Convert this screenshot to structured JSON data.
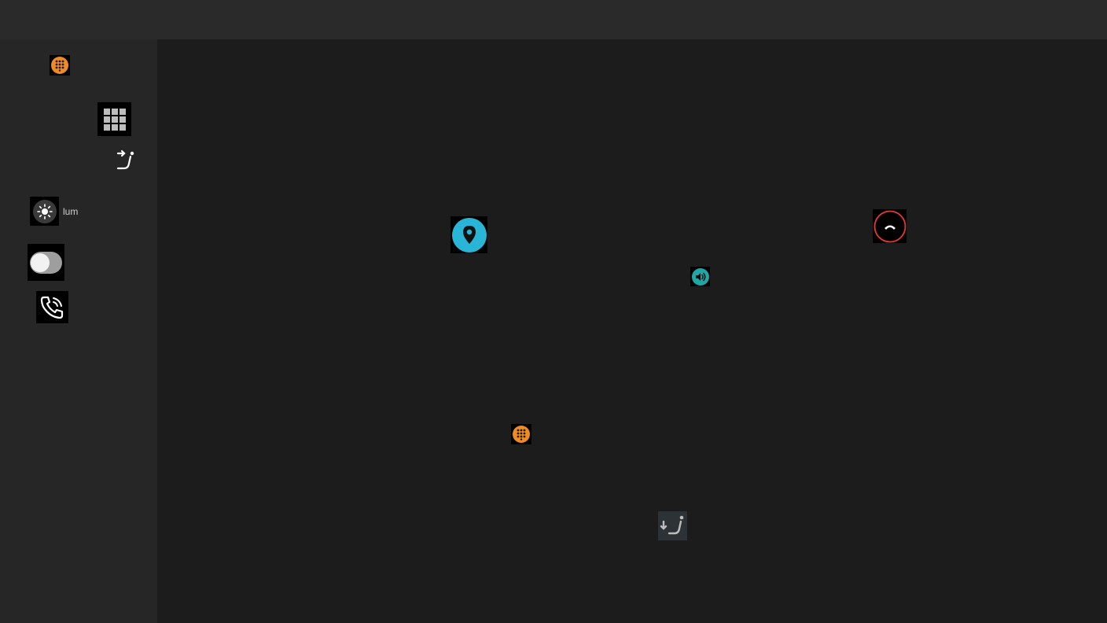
{
  "topbar": {},
  "sidebar": {
    "items": [
      {
        "icon": "dialpad-icon",
        "color": "#f08a24"
      },
      {
        "icon": "grid-icon",
        "color": "#bdbdbd"
      },
      {
        "icon": "seat-recline-icon",
        "color": "#ffffff"
      },
      {
        "icon": "brightness-icon",
        "label": "lum",
        "color": "#ffffff"
      },
      {
        "icon": "toggle-switch",
        "state": "off",
        "color": "#bdbdbd"
      },
      {
        "icon": "phone-in-talk-icon",
        "color": "#ffffff"
      }
    ]
  },
  "main": {
    "items": [
      {
        "icon": "location-pin-icon",
        "color": "#29b6d6"
      },
      {
        "icon": "end-call-icon",
        "color": "#e53935"
      },
      {
        "icon": "volume-icon",
        "color": "#1fa7a7"
      },
      {
        "icon": "dialpad-icon",
        "color": "#f08a24"
      },
      {
        "icon": "seat-recline-down-icon",
        "color": "#bdbdbd"
      }
    ]
  }
}
